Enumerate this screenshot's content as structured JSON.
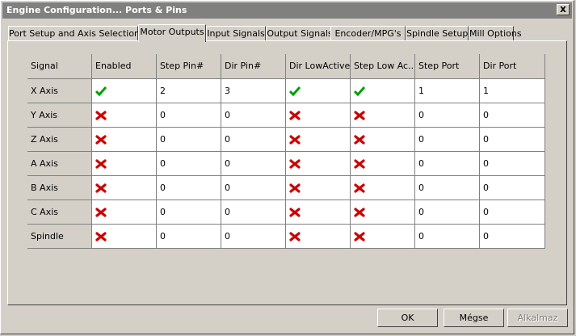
{
  "window": {
    "title": "Engine Configuration... Ports & Pins",
    "close_label": "x"
  },
  "tabs": [
    {
      "label": "Port Setup and Axis Selection"
    },
    {
      "label": "Motor Outputs"
    },
    {
      "label": "Input Signals"
    },
    {
      "label": "Output Signals"
    },
    {
      "label": "Encoder/MPG's"
    },
    {
      "label": "Spindle Setup"
    },
    {
      "label": "Mill Options"
    }
  ],
  "active_tab": "Motor Outputs",
  "table": {
    "columns": [
      "Signal",
      "Enabled",
      "Step Pin#",
      "Dir Pin#",
      "Dir LowActive",
      "Step Low Ac...",
      "Step Port",
      "Dir Port"
    ],
    "rows": [
      {
        "signal": "X Axis",
        "enabled": true,
        "step_pin": "2",
        "dir_pin": "3",
        "dir_low_active": true,
        "step_low_active": true,
        "step_port": "1",
        "dir_port": "1"
      },
      {
        "signal": "Y Axis",
        "enabled": false,
        "step_pin": "0",
        "dir_pin": "0",
        "dir_low_active": false,
        "step_low_active": false,
        "step_port": "0",
        "dir_port": "0"
      },
      {
        "signal": "Z Axis",
        "enabled": false,
        "step_pin": "0",
        "dir_pin": "0",
        "dir_low_active": false,
        "step_low_active": false,
        "step_port": "0",
        "dir_port": "0"
      },
      {
        "signal": "A Axis",
        "enabled": false,
        "step_pin": "0",
        "dir_pin": "0",
        "dir_low_active": false,
        "step_low_active": false,
        "step_port": "0",
        "dir_port": "0"
      },
      {
        "signal": "B Axis",
        "enabled": false,
        "step_pin": "0",
        "dir_pin": "0",
        "dir_low_active": false,
        "step_low_active": false,
        "step_port": "0",
        "dir_port": "0"
      },
      {
        "signal": "C Axis",
        "enabled": false,
        "step_pin": "0",
        "dir_pin": "0",
        "dir_low_active": false,
        "step_low_active": false,
        "step_port": "0",
        "dir_port": "0"
      },
      {
        "signal": "Spindle",
        "enabled": false,
        "step_pin": "0",
        "dir_pin": "0",
        "dir_low_active": false,
        "step_low_active": false,
        "step_port": "0",
        "dir_port": "0"
      }
    ]
  },
  "icons": {
    "true": "green-checkmark-icon",
    "false": "red-x-icon"
  },
  "colors": {
    "check": "#00a000",
    "cross": "#cc0000",
    "titlebar": "#808080",
    "face": "#d4d0c8"
  },
  "buttons": {
    "ok": "OK",
    "cancel": "Mégse",
    "apply": "Alkalmaz"
  }
}
